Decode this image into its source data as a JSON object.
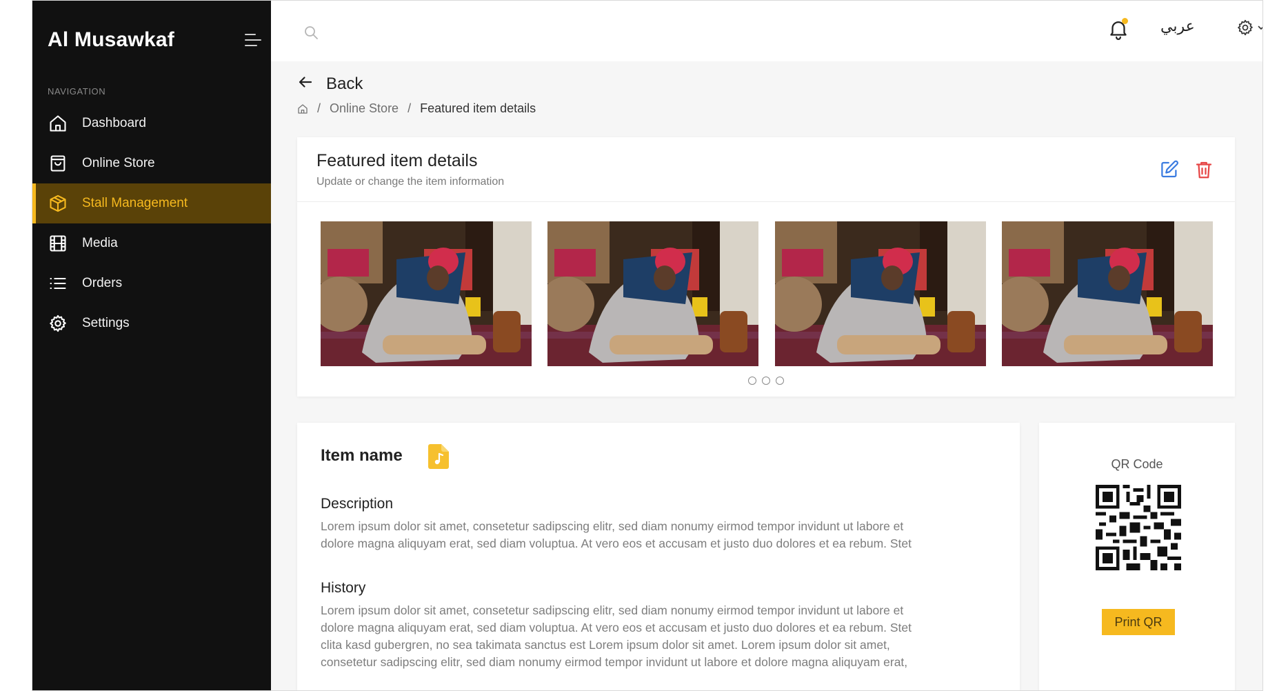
{
  "app": {
    "name": "Al Musawkaf"
  },
  "sidebar": {
    "caption": "NAVIGATION",
    "items": [
      {
        "label": "Dashboard",
        "icon": "home-icon"
      },
      {
        "label": "Online Store",
        "icon": "shopping-bag-icon"
      },
      {
        "label": "Stall Management",
        "icon": "box-icon",
        "active": true
      },
      {
        "label": "Media",
        "icon": "film-icon"
      },
      {
        "label": "Orders",
        "icon": "list-icon"
      },
      {
        "label": "Settings",
        "icon": "gear-icon"
      }
    ]
  },
  "topbar": {
    "language": "عربي"
  },
  "page": {
    "back_label": "Back",
    "breadcrumb": {
      "parent": "Online Store",
      "current": "Featured item details",
      "separator": "/"
    }
  },
  "featured": {
    "title": "Featured item details",
    "subtitle": "Update or change the item information",
    "photo_count": 4,
    "pagination_dots": 3
  },
  "item": {
    "name_label": "Item name",
    "description_title": "Description",
    "description_lines": [
      "Lorem ipsum dolor sit amet, consetetur sadipscing elitr, sed diam nonumy eirmod tempor invidunt ut labore et",
      "dolore magna aliquyam erat, sed diam voluptua. At vero eos et accusam et justo duo dolores et ea rebum. Stet"
    ],
    "history_title": "History",
    "history_lines": [
      "Lorem ipsum dolor sit amet, consetetur sadipscing elitr, sed diam nonumy eirmod tempor invidunt ut labore et",
      "dolore magna aliquyam erat, sed diam voluptua. At vero eos et accusam et justo duo dolores et ea rebum. Stet",
      "clita kasd gubergren, no sea takimata sanctus est Lorem ipsum dolor sit amet. Lorem ipsum dolor sit amet,",
      "consetetur sadipscing elitr, sed diam nonumy eirmod tempor invidunt ut labore et dolore magna aliquyam erat,"
    ]
  },
  "qr": {
    "label": "QR Code",
    "print_label": "Print QR"
  },
  "colors": {
    "accent": "#f6b91f",
    "sidebar_bg": "#111111",
    "active_bg": "#5a4208",
    "edit": "#3a7be0",
    "delete": "#e64545"
  }
}
